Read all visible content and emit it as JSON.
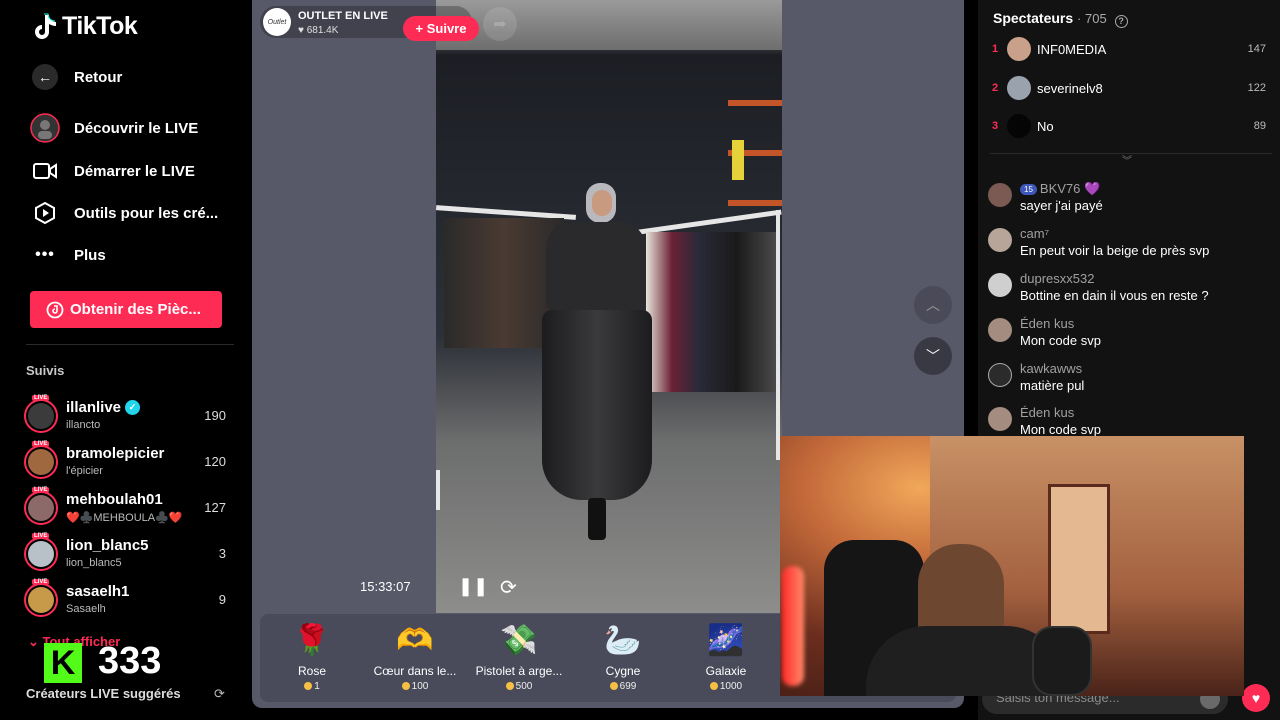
{
  "brand": {
    "name": "TikTok"
  },
  "nav": {
    "back": "Retour",
    "discover": "Découvrir le LIVE",
    "start": "Démarrer le LIVE",
    "tools": "Outils pour les cré...",
    "more": "Plus",
    "coins": "Obtenir des Pièc..."
  },
  "followed": {
    "title": "Suivis",
    "items": [
      {
        "name": "illanlive",
        "sub": "illancto",
        "count": "190",
        "verified": true
      },
      {
        "name": "bramolepicier",
        "sub": "l'épicier",
        "count": "120"
      },
      {
        "name": "mehboulah01",
        "sub": "❤️♣️MEHBOULA♣️❤️",
        "count": "127"
      },
      {
        "name": "lion_blanc5",
        "sub": "lion_blanc5",
        "count": "3"
      },
      {
        "name": "sasaelh1",
        "sub": "Sasaelh",
        "count": "9"
      }
    ],
    "live_tag": "LIVE",
    "see_all": "Tout afficher",
    "suggested": "Créateurs LIVE suggérés"
  },
  "overlay_counter": {
    "letter": "K",
    "value": "333"
  },
  "stream": {
    "host": "OUTLET EN LIVE",
    "host_avatar_text": "Outlet",
    "likes": "681.4K",
    "follow_label": "+ Suivre",
    "time": "15:33:07"
  },
  "gifts": [
    {
      "name": "Rose",
      "price": "1",
      "icon": "🌹"
    },
    {
      "name": "Cœur dans le...",
      "price": "100",
      "icon": "🫶"
    },
    {
      "name": "Pistolet à arge...",
      "price": "500",
      "icon": "💸"
    },
    {
      "name": "Cygne",
      "price": "699",
      "icon": "🦢"
    },
    {
      "name": "Galaxie",
      "price": "1000",
      "icon": "🌌"
    }
  ],
  "viewers": {
    "title": "Spectateurs",
    "count": "· 705",
    "top": [
      {
        "rank": "1",
        "name": "INF0MEDIA",
        "score": "147",
        "color": "#c9a08a"
      },
      {
        "rank": "2",
        "name": "severinelv8",
        "score": "122",
        "color": "#9aa3ad"
      },
      {
        "rank": "3",
        "name": "No",
        "score": "89",
        "color": "#050505"
      }
    ]
  },
  "chat": [
    {
      "user": "BKV76 💜",
      "level": "15",
      "msg": "sayer j'ai payé"
    },
    {
      "user": "cam⁷",
      "msg": "En peut voir la beige de près svp"
    },
    {
      "user": "dupresxx532",
      "msg": "Bottine en dain il vous en reste ?"
    },
    {
      "user": "Éden kus",
      "msg": "Mon code svp"
    },
    {
      "user": "kawkawws",
      "msg": "matière pul"
    },
    {
      "user": "Éden kus",
      "msg": "Mon code svp"
    }
  ],
  "input": {
    "placeholder": "Saisis ton message..."
  },
  "colors": {
    "accent": "#fe2c55",
    "panel": "#575868",
    "kick": "#53fc18"
  }
}
